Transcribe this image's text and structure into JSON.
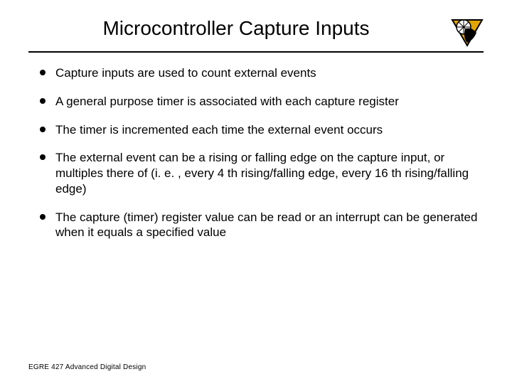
{
  "title": "Microcontroller Capture Inputs",
  "logo_alt": "ram-logo",
  "bullets": {
    "0": "Capture inputs are used to count external events",
    "1": "A general purpose timer is associated with each capture register",
    "2": "The timer is incremented each time the external event occurs",
    "3": "The external event can be a rising or falling edge on the capture input, or multiples there of (i. e. , every 4 th rising/falling edge, every 16 th rising/falling edge)",
    "4": "The capture (timer) register value can be read or an interrupt can be generated when it equals a specified value"
  },
  "footer": "EGRE 427 Advanced Digital Design"
}
